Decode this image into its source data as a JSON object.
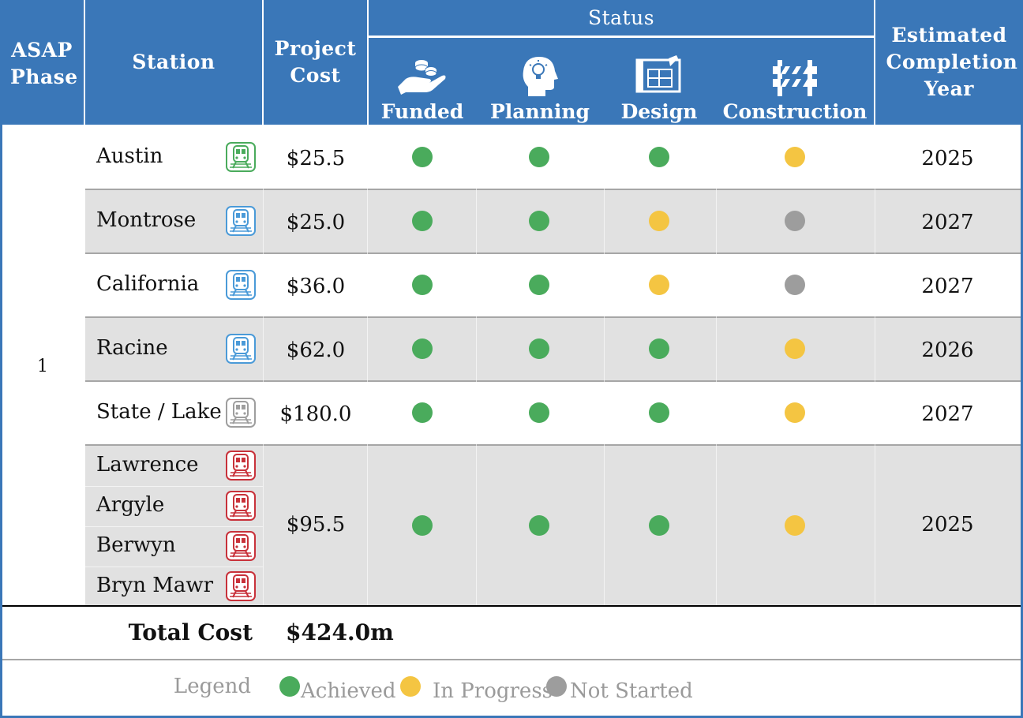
{
  "header": {
    "phase": "ASAP Phase",
    "station": "Station",
    "cost": "Project Cost",
    "status": "Status",
    "year": "Estimated Completion Year",
    "status_cols": [
      {
        "label": "Funded",
        "icon": "hand-coins-icon"
      },
      {
        "label": "Planning",
        "icon": "head-lightbulb-icon"
      },
      {
        "label": "Design",
        "icon": "blueprint-icon"
      },
      {
        "label": "Construction",
        "icon": "barrier-icon"
      }
    ]
  },
  "colors": {
    "header_bg": "#3a77b8",
    "achieved": "#4aab5c",
    "in_progress": "#f4c542",
    "not_started": "#9d9d9d",
    "green_line": "#4aab5c",
    "blue_line": "#4a9ad8",
    "gray_line": "#9e9e9e",
    "red_line": "#c8313a"
  },
  "phase_value": "1",
  "rows": [
    {
      "station": "Austin",
      "line": "green",
      "cost": "$25.5",
      "status": [
        "achieved",
        "achieved",
        "achieved",
        "in_progress"
      ],
      "year": "2025"
    },
    {
      "station": "Montrose",
      "line": "blue",
      "cost": "$25.0",
      "status": [
        "achieved",
        "achieved",
        "in_progress",
        "not_started"
      ],
      "year": "2027"
    },
    {
      "station": "California",
      "line": "blue",
      "cost": "$36.0",
      "status": [
        "achieved",
        "achieved",
        "in_progress",
        "not_started"
      ],
      "year": "2027"
    },
    {
      "station": "Racine",
      "line": "blue",
      "cost": "$62.0",
      "status": [
        "achieved",
        "achieved",
        "achieved",
        "in_progress"
      ],
      "year": "2026"
    },
    {
      "station": "State / Lake",
      "line": "gray",
      "cost": "$180.0",
      "status": [
        "achieved",
        "achieved",
        "achieved",
        "in_progress"
      ],
      "year": "2027"
    }
  ],
  "group": {
    "stations": [
      "Lawrence",
      "Argyle",
      "Berwyn",
      "Bryn Mawr"
    ],
    "line": "red",
    "cost": "$95.5",
    "status": [
      "achieved",
      "achieved",
      "achieved",
      "in_progress"
    ],
    "year": "2025"
  },
  "total": {
    "label": "Total Cost",
    "value": "$424.0m"
  },
  "legend": {
    "label": "Legend",
    "items": [
      {
        "key": "achieved",
        "label": "Achieved"
      },
      {
        "key": "in_progress",
        "label": "In Progress"
      },
      {
        "key": "not_started",
        "label": "Not Started"
      }
    ]
  }
}
